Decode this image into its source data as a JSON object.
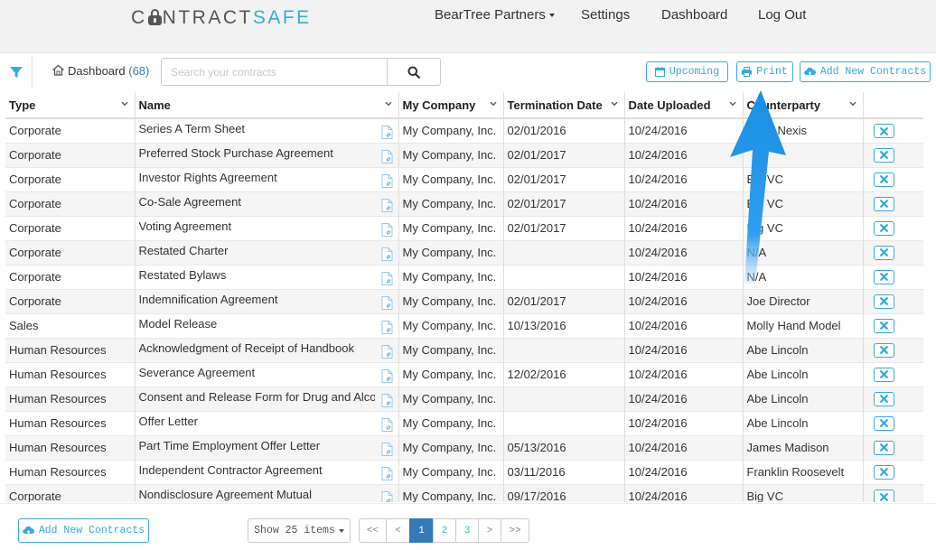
{
  "brand": {
    "logo_left": "C",
    "logo_mid": "NTRACT",
    "logo_right": "SAFE"
  },
  "nav": {
    "account": "BearTree Partners",
    "settings": "Settings",
    "dashboard": "Dashboard",
    "logout": "Log Out"
  },
  "toolbar": {
    "dashboard_label": "Dashboard",
    "dashboard_count": "(68)",
    "search_placeholder": "Search your contracts",
    "upcoming": "Upcoming",
    "print": "Print",
    "add_new": "Add New Contracts"
  },
  "table": {
    "columns": [
      "Type",
      "Name",
      "My Company",
      "Termination Date",
      "Date Uploaded",
      "Counterparty"
    ],
    "rows": [
      [
        "Corporate",
        "Series A Term Sheet",
        "My Company, Inc.",
        "02/01/2016",
        "10/24/2016",
        "Lexis Nexis"
      ],
      [
        "Corporate",
        "Preferred Stock Purchase Agreement",
        "My Company, Inc.",
        "02/01/2017",
        "10/24/2016",
        ""
      ],
      [
        "Corporate",
        "Investor Rights Agreement",
        "My Company, Inc.",
        "02/01/2017",
        "10/24/2016",
        "Big VC"
      ],
      [
        "Corporate",
        "Co-Sale Agreement",
        "My Company, Inc.",
        "02/01/2017",
        "10/24/2016",
        "Big VC"
      ],
      [
        "Corporate",
        "Voting Agreement",
        "My Company, Inc.",
        "02/01/2017",
        "10/24/2016",
        "Big VC"
      ],
      [
        "Corporate",
        "Restated Charter",
        "My Company, Inc.",
        "",
        "10/24/2016",
        "N/A"
      ],
      [
        "Corporate",
        "Restated Bylaws",
        "My Company, Inc.",
        "",
        "10/24/2016",
        "N/A"
      ],
      [
        "Corporate",
        "Indemnification Agreement",
        "My Company, Inc.",
        "02/01/2017",
        "10/24/2016",
        "Joe Director"
      ],
      [
        "Sales",
        "Model Release",
        "My Company, Inc.",
        "10/13/2016",
        "10/24/2016",
        "Molly Hand Model"
      ],
      [
        "Human Resources",
        "Acknowledgment of Receipt of Handbook",
        "My Company, Inc.",
        "",
        "10/24/2016",
        "Abe Lincoln"
      ],
      [
        "Human Resources",
        "Severance Agreement",
        "My Company, Inc.",
        "12/02/2016",
        "10/24/2016",
        "Abe Lincoln"
      ],
      [
        "Human Resources",
        "Consent and Release Form for Drug and Alcohol Testing",
        "My Company, Inc.",
        "",
        "10/24/2016",
        "Abe Lincoln"
      ],
      [
        "Human Resources",
        "Offer Letter",
        "My Company, Inc.",
        "",
        "10/24/2016",
        "Abe Lincoln"
      ],
      [
        "Human Resources",
        "Part Time Employment Offer Letter",
        "My Company, Inc.",
        "05/13/2016",
        "10/24/2016",
        "James Madison"
      ],
      [
        "Human Resources",
        "Independent Contractor Agreement",
        "My Company, Inc.",
        "03/11/2016",
        "10/24/2016",
        "Franklin Roosevelt"
      ],
      [
        "Corporate",
        "Nondisclosure Agreement Mutual",
        "My Company, Inc.",
        "09/17/2016",
        "10/24/2016",
        "Big VC"
      ]
    ]
  },
  "footer": {
    "add_new": "Add New Contracts",
    "show_items": "Show 25 items",
    "pager": [
      "<<",
      "<",
      "1",
      "2",
      "3",
      ">",
      ">>"
    ],
    "current_page": "1"
  },
  "colors": {
    "accent": "#36a9e1",
    "active_page": "#337ab7",
    "annotation_arrow": "#1a8fe3"
  },
  "icons": {
    "filter": "funnel-icon",
    "home": "home-icon",
    "search": "search-icon",
    "upcoming": "calendar-icon",
    "print": "printer-icon",
    "add": "cloud-upload-icon",
    "document": "document-icon",
    "delete": "close-icon"
  }
}
